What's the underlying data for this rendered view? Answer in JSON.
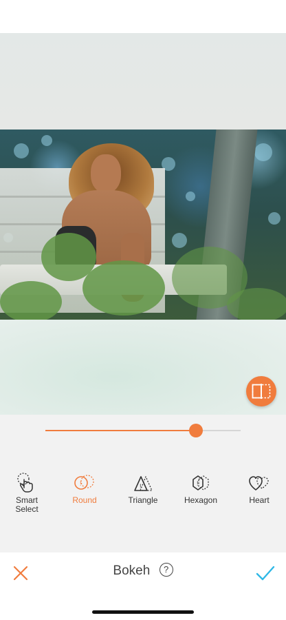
{
  "editor": {
    "compare_button": {
      "icon": "compare-split-icon",
      "color": "#f07c3d"
    },
    "slider": {
      "value_percent": 77,
      "accent": "#f07c3d"
    }
  },
  "tools": [
    {
      "label": "Smart\nSelect",
      "icon": "hand-select-icon",
      "active": false
    },
    {
      "label": "Round",
      "icon": "round-bokeh-icon",
      "active": true
    },
    {
      "label": "Triangle",
      "icon": "triangle-bokeh-icon",
      "active": false
    },
    {
      "label": "Hexagon",
      "icon": "hexagon-bokeh-icon",
      "active": false
    },
    {
      "label": "Heart",
      "icon": "heart-bokeh-icon",
      "active": false
    }
  ],
  "bottom_bar": {
    "title": "Bokeh",
    "help_label": "?",
    "cancel_icon": "close-icon",
    "confirm_icon": "checkmark-icon",
    "cancel_color": "#f07c3d",
    "confirm_color": "#2fb8e6"
  }
}
